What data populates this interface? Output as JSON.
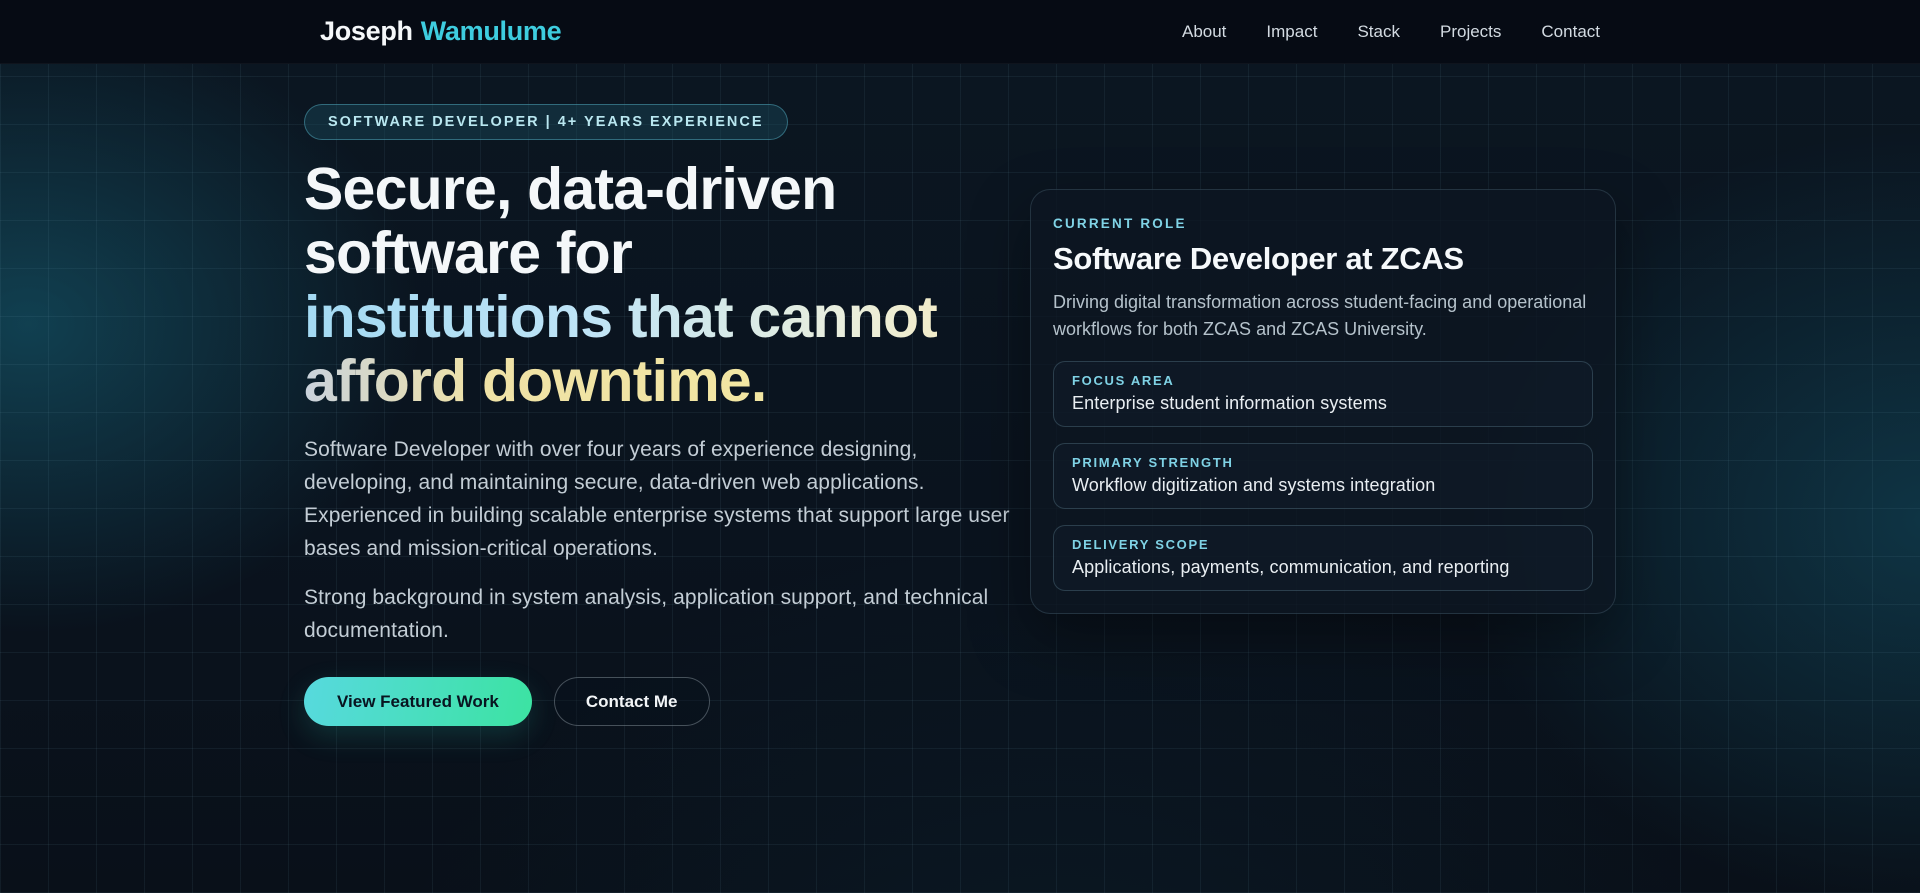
{
  "brand": {
    "first": "Joseph",
    "last": "Wamulume"
  },
  "nav": {
    "items": [
      {
        "label": "About"
      },
      {
        "label": "Impact"
      },
      {
        "label": "Stack"
      },
      {
        "label": "Projects"
      },
      {
        "label": "Contact"
      }
    ]
  },
  "hero": {
    "badge": "SOFTWARE DEVELOPER | 4+ YEARS EXPERIENCE",
    "heading": {
      "line1": "Secure, data-driven",
      "line2": "software for",
      "line3": "institutions that cannot",
      "line4": "afford downtime."
    },
    "paragraph1": "Software Developer with over four years of experience designing, developing, and maintaining secure, data-driven web applications. Experienced in building scalable enterprise systems that support large user bases and mission-critical operations.",
    "paragraph2": "Strong background in system analysis, application support, and technical documentation.",
    "primary_cta": "View Featured Work",
    "secondary_cta": "Contact Me"
  },
  "role_card": {
    "label": "CURRENT ROLE",
    "title": "Software Developer at ZCAS",
    "description": "Driving digital transformation across student-facing and operational workflows for both ZCAS and ZCAS University.",
    "items": [
      {
        "label": "FOCUS AREA",
        "value": "Enterprise student information systems"
      },
      {
        "label": "PRIMARY STRENGTH",
        "value": "Workflow digitization and systems integration"
      },
      {
        "label": "DELIVERY SCOPE",
        "value": "Applications, payments, communication, and reporting"
      }
    ]
  },
  "colors": {
    "accent_cyan": "#3ecddf",
    "label_cyan": "#7fd2e5",
    "heading_blue": "#a3daf3",
    "heading_cream": "#f2e6a2",
    "button_gradient_start": "#57d9de",
    "button_gradient_end": "#3ce3a2",
    "background": "#0a111c",
    "navbar_background": "#060b14"
  }
}
